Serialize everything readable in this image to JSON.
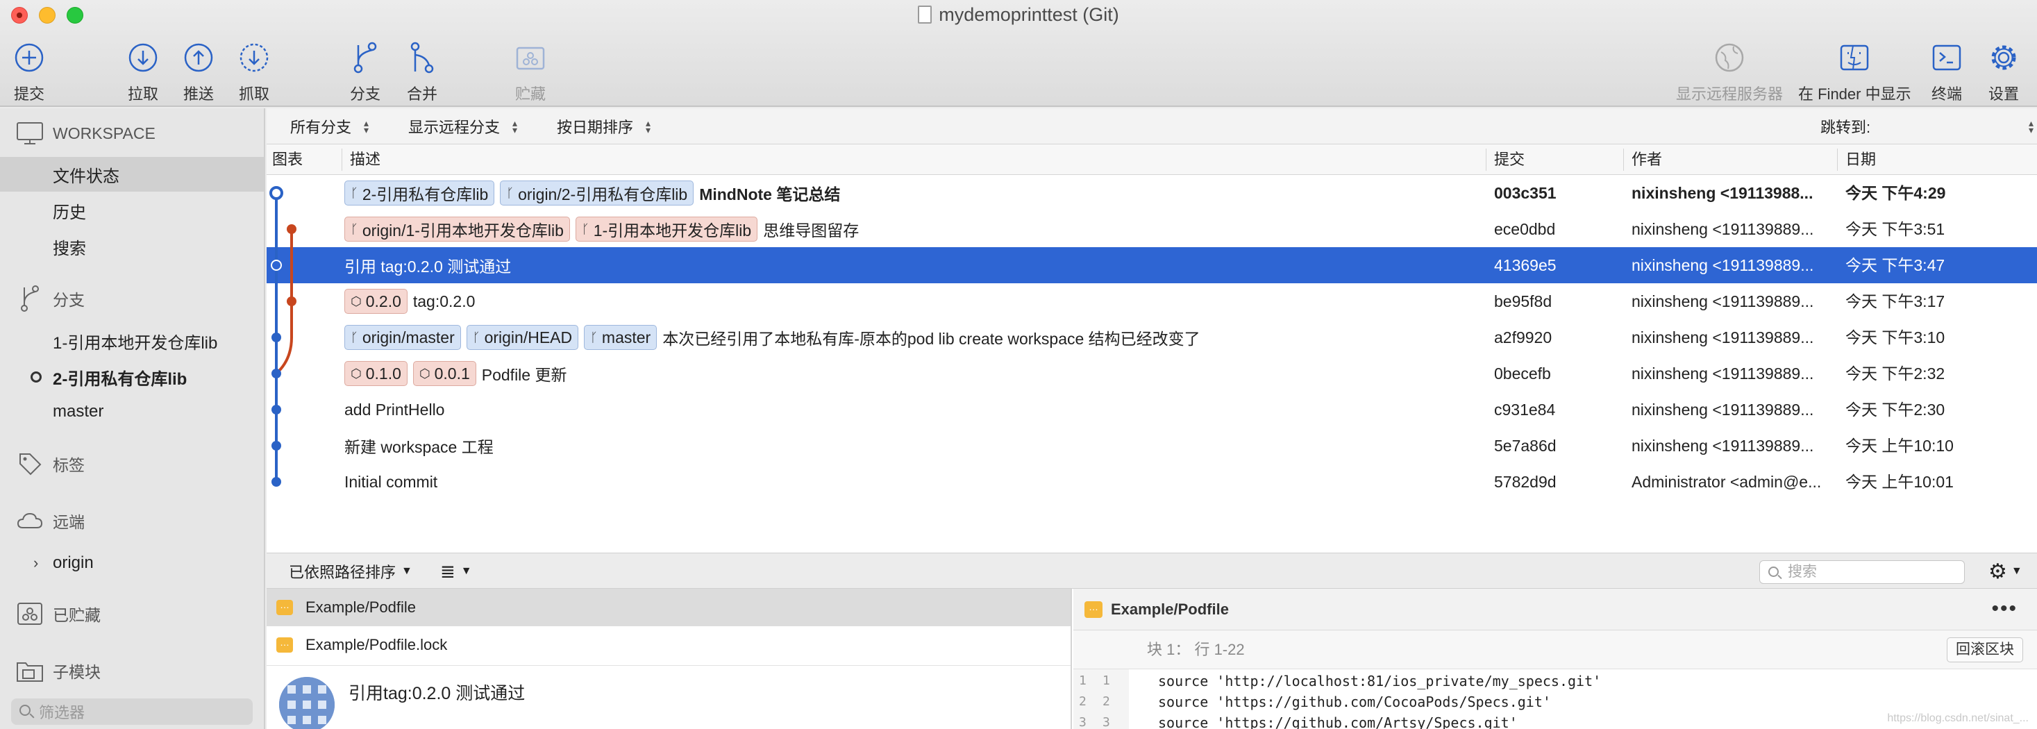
{
  "window": {
    "title": "mydemoprinttest (Git)"
  },
  "toolbar": {
    "commit": "提交",
    "pull": "拉取",
    "push": "推送",
    "fetch": "抓取",
    "branch": "分支",
    "merge": "合并",
    "stash": "贮藏",
    "show_remote": "显示远程服务器",
    "show_in_finder": "在 Finder 中显示",
    "terminal": "终端",
    "settings": "设置"
  },
  "sidebar": {
    "workspace": "WORKSPACE",
    "file_status": "文件状态",
    "history": "历史",
    "search": "搜索",
    "branches_header": "分支",
    "branches": [
      "1-引用本地开发仓库lib",
      "2-引用私有仓库lib",
      "master"
    ],
    "tags_header": "标签",
    "remotes_header": "远端",
    "remote_origin": "origin",
    "stashes_header": "已贮藏",
    "submodules_header": "子模块",
    "filter_placeholder": "筛选器"
  },
  "filterbar": {
    "all_branches": "所有分支",
    "show_remote_branches": "显示远程分支",
    "sort_by_date": "按日期排序",
    "jump_to": "跳转到:"
  },
  "columns": {
    "graph": "图表",
    "description": "描述",
    "commit": "提交",
    "author": "作者",
    "date": "日期"
  },
  "commits": [
    {
      "tags": [
        [
          "2-引用私有仓库lib",
          "branch"
        ],
        [
          "origin/2-引用私有仓库lib",
          "branch"
        ]
      ],
      "message": "MindNote 笔记总结",
      "hash": "003c351",
      "author": "nixinsheng <19113988...",
      "date": "今天 下午4:29"
    },
    {
      "tags": [
        [
          "origin/1-引用本地开发仓库lib",
          "branch"
        ],
        [
          "1-引用本地开发仓库lib",
          "branch"
        ]
      ],
      "message": "思维导图留存",
      "hash": "ece0dbd",
      "author": "nixinsheng <191139889...",
      "date": "今天 下午3:51"
    },
    {
      "tags": [],
      "message": "引用 tag:0.2.0 测试通过",
      "hash": "41369e5",
      "author": "nixinsheng <191139889...",
      "date": "今天 下午3:47"
    },
    {
      "tags": [
        [
          "0.2.0",
          "tag"
        ]
      ],
      "message": "tag:0.2.0",
      "hash": "be95f8d",
      "author": "nixinsheng <191139889...",
      "date": "今天 下午3:17"
    },
    {
      "tags": [
        [
          "origin/master",
          "branch"
        ],
        [
          "origin/HEAD",
          "branch"
        ],
        [
          "master",
          "branch"
        ]
      ],
      "message": "本次已经引用了本地私有库-原本的pod lib create workspace 结构已经改变了",
      "hash": "a2f9920",
      "author": "nixinsheng <191139889...",
      "date": "今天 下午3:10"
    },
    {
      "tags": [
        [
          "0.1.0",
          "tag"
        ],
        [
          "0.0.1",
          "tag"
        ]
      ],
      "message": "Podfile 更新",
      "hash": "0becefb",
      "author": "nixinsheng <191139889...",
      "date": "今天 下午2:32"
    },
    {
      "tags": [],
      "message": "add PrintHello",
      "hash": "c931e84",
      "author": "nixinsheng <191139889...",
      "date": "今天 下午2:30"
    },
    {
      "tags": [],
      "message": "新建 workspace 工程",
      "hash": "5e7a86d",
      "author": "nixinsheng <191139889...",
      "date": "今天 上午10:10"
    },
    {
      "tags": [],
      "message": "Initial commit",
      "hash": "5782d9d",
      "author": "Administrator <admin@e...",
      "date": "今天 上午10:01"
    }
  ],
  "bottombar": {
    "sort_by_path": "已依照路径排序",
    "search_placeholder": "搜索"
  },
  "files": [
    "Example/Podfile",
    "Example/Podfile.lock"
  ],
  "commit_detail": {
    "message": "引用tag:0.2.0 测试通过"
  },
  "diff": {
    "filename": "Example/Podfile",
    "hunk_label": "块 1： 行 1-22",
    "revert_button": "回滚区块",
    "lines": [
      {
        "old": "1",
        "new": "1",
        "text": "source 'http://localhost:81/ios_private/my_specs.git'"
      },
      {
        "old": "2",
        "new": "2",
        "text": "source 'https://github.com/CocoaPods/Specs.git'"
      },
      {
        "old": "3",
        "new": "3",
        "text": "source 'https://github.com/Artsy/Specs.git'"
      }
    ]
  },
  "watermark": "https://blog.csdn.net/sinat_...",
  "colors": {
    "selection": "#2e65d3",
    "graph_blue": "#2a62c6",
    "graph_red": "#c8461e",
    "branch_tag": "#d5e3f6",
    "local_tag": "#f6d8d2"
  }
}
